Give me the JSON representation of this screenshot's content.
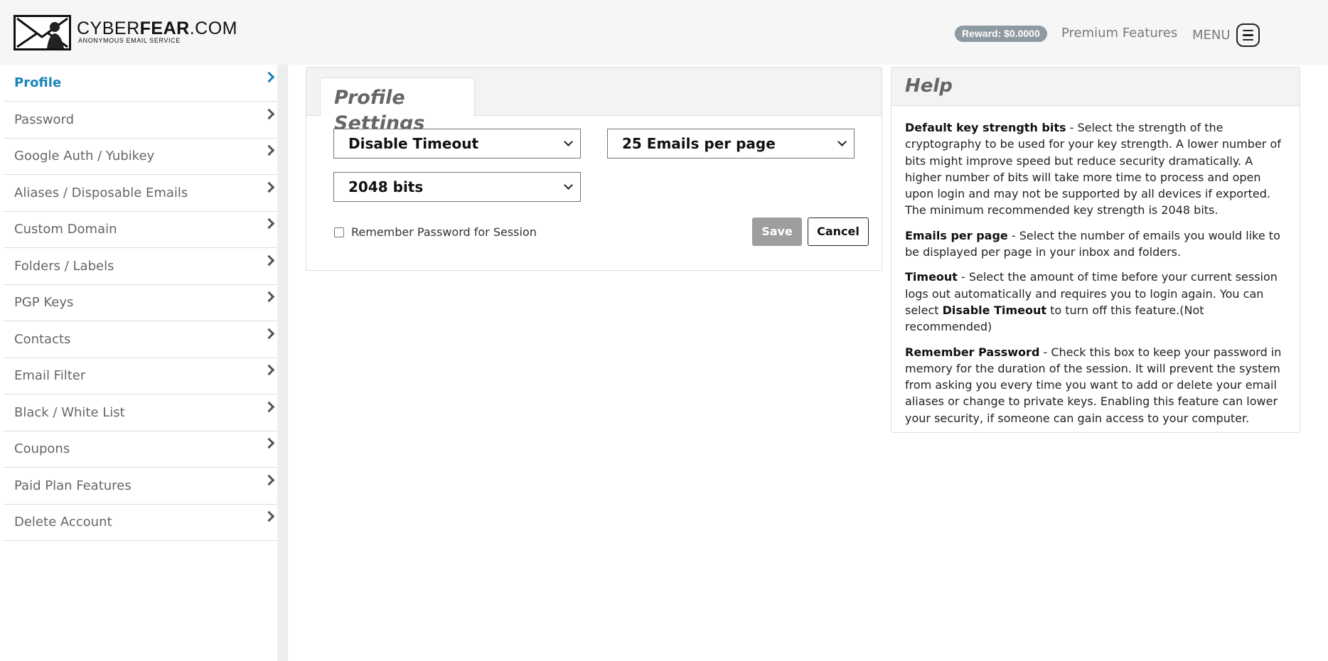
{
  "header": {
    "logo_title_light": "CYBER",
    "logo_title_bold": "FEAR",
    "logo_title_suffix": ".COM",
    "logo_subtitle": "ANONYMOUS EMAIL SERVICE",
    "reward": "Reward: $0.0000",
    "premium": "Premium Features",
    "menu": "MENU"
  },
  "sidebar": {
    "items": [
      {
        "label": "Profile"
      },
      {
        "label": "Password"
      },
      {
        "label": "Google Auth / Yubikey"
      },
      {
        "label": "Aliases / Disposable Emails"
      },
      {
        "label": "Custom Domain"
      },
      {
        "label": "Folders / Labels"
      },
      {
        "label": "PGP Keys"
      },
      {
        "label": "Contacts"
      },
      {
        "label": "Email Filter"
      },
      {
        "label": "Black / White List"
      },
      {
        "label": "Coupons"
      },
      {
        "label": "Paid Plan Features"
      },
      {
        "label": "Delete Account"
      }
    ],
    "active_index": 0
  },
  "profile": {
    "tab_title": "Profile Settings",
    "timeout_value": "Disable Timeout",
    "emails_per_page_value": "25 Emails per page",
    "key_strength_value": "2048 bits",
    "remember_label": "Remember Password for Session",
    "remember_checked": false,
    "save_label": "Save",
    "cancel_label": "Cancel"
  },
  "help": {
    "title": "Help",
    "key_term": "Default key strength bits",
    "key_text": " - Select the strength of the cryptography to be used for your key strength. A lower number of bits might improve speed but reduce security dramatically. A higher number of bits will take more time to process and open upon login and may not be supported by all devices if exported. The minimum recommended key strength is 2048 bits.",
    "emails_term": "Emails per page",
    "emails_text": " - Select the number of emails you would like to be displayed per page in your inbox and folders.",
    "timeout_term": "Timeout",
    "timeout_text": " - Select the amount of time before your current session logs out automatically and requires you to login again. You can select ",
    "timeout_term2": "Disable Timeout",
    "timeout_text2": " to turn off this feature.(Not recommended)",
    "remember_term": "Remember Password",
    "remember_text": " - Check this box to keep your password in memory for the duration of the session. It will prevent the system from asking you every time you want to add or delete your email aliases or change to private keys. Enabling this feature can lower your security, if someone can gain access to your computer."
  },
  "colors": {
    "accent": "#1a85b8",
    "header_bg": "#f6f6f6",
    "reward_badge": "#8e9aa2",
    "save_disabled": "#9e9e9e"
  }
}
